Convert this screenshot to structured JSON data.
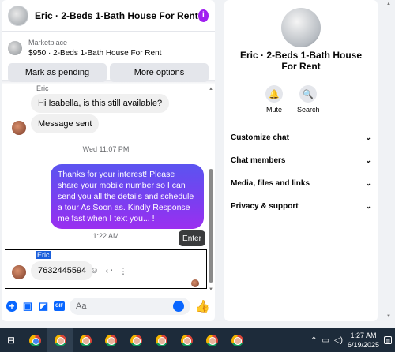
{
  "chat": {
    "title": "Eric · 2-Beds 1-Bath House For Rent",
    "marketplace_label": "Marketplace",
    "listing": "$950 · 2-Beds 1-Bath House For Rent",
    "mark_pending_label": "Mark as pending",
    "more_options_label": "More options",
    "sender_name": "Eric",
    "messages": [
      {
        "text": "Hi Isabella, is this still available?"
      },
      {
        "text": "Message sent"
      }
    ],
    "timestamp_1": "Wed 11:07 PM",
    "outgoing_message": "Thanks for your interest! Please share your mobile number so I can send you all the details and schedule a tour As Soon as. Kindly Response me fast when I text you... !",
    "timestamp_2": "1:22 AM",
    "enter_tooltip": "Enter",
    "selected_sender": "Eric",
    "phone_message": "7632445594",
    "composer_placeholder": "Aa"
  },
  "info_panel": {
    "title": "Eric · 2-Beds 1-Bath House For Rent",
    "mute_label": "Mute",
    "search_label": "Search",
    "sections": [
      {
        "label": "Customize chat"
      },
      {
        "label": "Chat members"
      },
      {
        "label": "Media, files and links"
      },
      {
        "label": "Privacy & support"
      }
    ]
  },
  "taskbar": {
    "time": "1:27 AM",
    "date": "6/19/2025"
  },
  "colors": {
    "accent": "#0866ff",
    "bubble_gradient_start": "#5b54f0",
    "bubble_gradient_end": "#9b2ff0",
    "info_icon": "#a020f0",
    "taskbar_bg": "#1d2b3a"
  },
  "icons": {
    "info": "info-icon",
    "mute": "bell-icon",
    "search": "search-icon",
    "composer": [
      "plus-icon",
      "image-icon",
      "sticker-icon",
      "gif-icon",
      "emoji-icon",
      "like-icon"
    ]
  }
}
